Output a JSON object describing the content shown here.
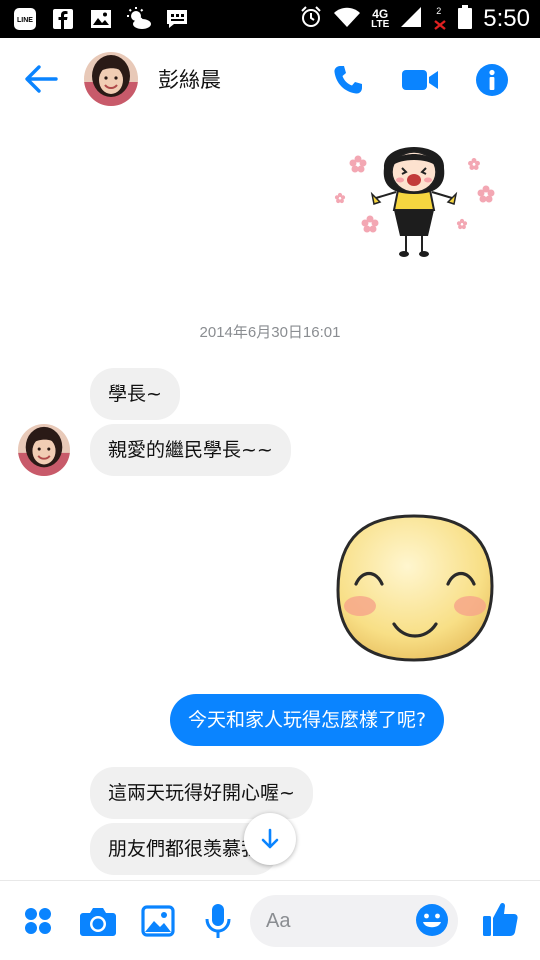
{
  "status_bar": {
    "time": "5:50",
    "network": "4G",
    "network_sub": "LTE",
    "sim_badge": "2",
    "left_icons": [
      "line-icon",
      "facebook-icon",
      "gallery-icon",
      "weather-icon",
      "chat-notification-icon"
    ],
    "right_icons": [
      "alarm-icon",
      "wifi-icon",
      "signal-icon",
      "no-signal-icon",
      "battery-icon"
    ]
  },
  "header": {
    "contact_name": "彭絲晨",
    "icons": [
      "back-arrow-icon",
      "phone-icon",
      "video-camera-icon",
      "info-icon"
    ]
  },
  "chat": {
    "timestamp": "2014年6月30日16:01",
    "incoming_1": "學長~",
    "incoming_2": "親愛的繼民學長~~",
    "outgoing_1": "今天和家人玩得怎麼樣了呢?",
    "incoming_3": "這兩天玩得好開心喔~",
    "incoming_4": "朋友們都很羡慕我"
  },
  "composer": {
    "placeholder": "Aa",
    "icons": [
      "more-icon",
      "camera-icon",
      "image-icon",
      "microphone-icon",
      "emoji-icon",
      "thumbs-up-icon"
    ]
  },
  "colors": {
    "accent": "#0a84ff",
    "incoming_bubble": "#f0f0f0",
    "timestamp_text": "#8a8d91"
  }
}
